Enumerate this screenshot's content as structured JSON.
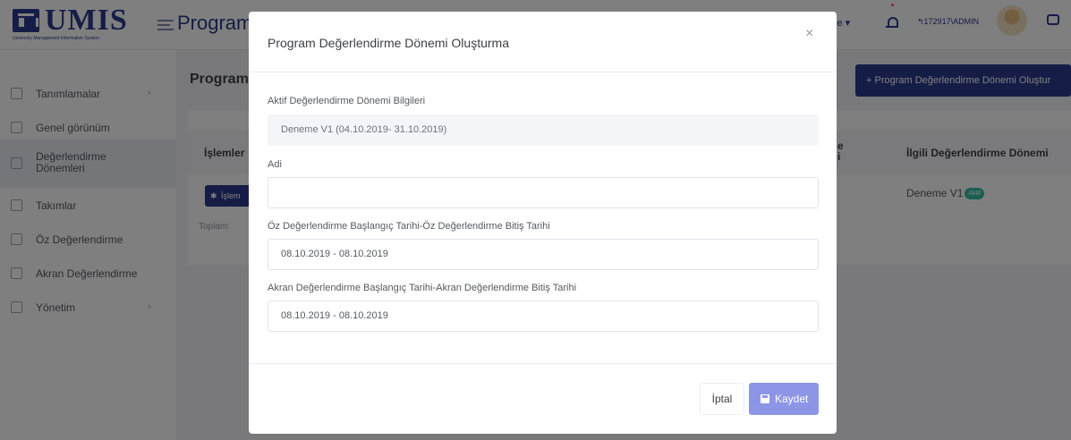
{
  "header": {
    "logo_text": "UMIS",
    "logo_subtitle": "University Management Information System",
    "app_title": "Program D",
    "language": "çe ▾",
    "user": "↰172917\\ADMIN"
  },
  "sidebar": {
    "items": [
      {
        "label": "Tanımlamalar",
        "has_arrow": true
      },
      {
        "label": "Genel görünüm"
      },
      {
        "label": "Değerlendirme Dönemleri",
        "active": true
      },
      {
        "label": "Takımlar"
      },
      {
        "label": "Öz Değerlendirme"
      },
      {
        "label": "Akran Değerlendirme"
      },
      {
        "label": "Yönetim",
        "has_arrow": true
      }
    ]
  },
  "page": {
    "title": "Program",
    "create_button": "Program Değerlendirme Dönemi Oluştur",
    "table_headers": [
      "İşlemler",
      "e\ni",
      "İlgili Değerlendirme Dönemi"
    ],
    "ops_button": "İşlem",
    "total_label": "Toplam:",
    "row_period": "Deneme V1",
    "row_badge": "Aktif"
  },
  "modal": {
    "title": "Program Değerlendirme Dönemi Oluşturma",
    "close": "×",
    "active_period_label": "Aktif Değerlendirme Dönemi Bilgileri",
    "active_period_value": "Deneme V1 (04.10.2019- 31.10.2019)",
    "name_label": "Adi",
    "name_value": "",
    "self_eval_label": "Öz Değerlendirme Başlangıç Tarihi-Öz Değerlendirme Bitiş Tarihi",
    "self_eval_value": "08.10.2019 - 08.10.2019",
    "peer_eval_label": "Akran Değerlendirme Başlangıç Tarihi-Akran Değerlendirme Bitiş Tarihi",
    "peer_eval_value": "08.10.2019 - 08.10.2019",
    "cancel_button": "İptal",
    "save_button": "Kaydet"
  }
}
